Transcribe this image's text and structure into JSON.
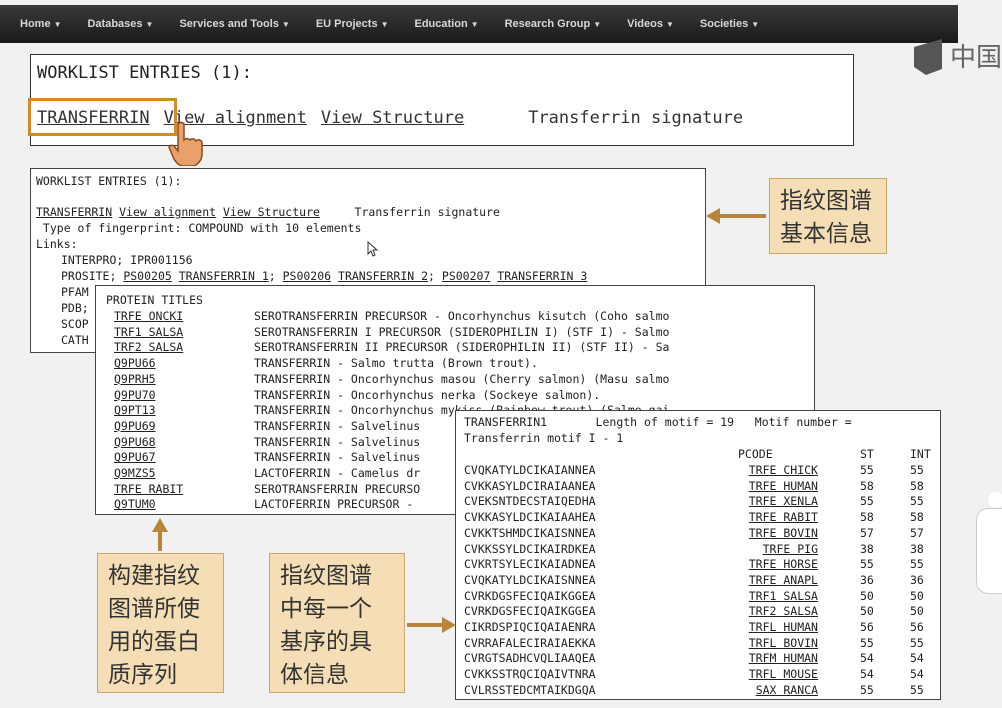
{
  "nav": [
    {
      "label": "Home"
    },
    {
      "label": "Databases"
    },
    {
      "label": "Services and Tools"
    },
    {
      "label": "EU Projects"
    },
    {
      "label": "Education"
    },
    {
      "label": "Research Group"
    },
    {
      "label": "Videos"
    },
    {
      "label": "Societies"
    }
  ],
  "logo_text": "中国",
  "big_box": {
    "title": "WORKLIST ENTRIES (1):",
    "link1": "TRANSFERRIN",
    "link2": "View alignment",
    "link3": "View Structure",
    "signature": "Transferrin signature"
  },
  "panel1": {
    "title": "WORKLIST ENTRIES (1):",
    "link1": "TRANSFERRIN",
    "link2": "View alignment",
    "link3": "View Structure",
    "signature": "Transferrin signature",
    "fingerprint": " Type of fingerprint: COMPOUND with 10 elements",
    "links_label": "Links:",
    "interpro": "INTERPRO; IPR001156",
    "prosite_prefix": "PROSITE;",
    "ps1": "PS00205",
    "ps1n": "TRANSFERRIN 1",
    "ps2": "PS00206",
    "ps2n": "TRANSFERRIN 2",
    "ps3": "PS00207",
    "ps3n": "TRANSFERRIN 3",
    "pfam": "PFAM",
    "pdb": "PDB;",
    "scop": "SCOP",
    "cath": "CATH"
  },
  "panel2": {
    "header": "PROTEIN TITLES",
    "rows": [
      {
        "id": "TRFE ONCKI",
        "title": "SEROTRANSFERRIN PRECURSOR - Oncorhynchus kisutch (Coho salmo"
      },
      {
        "id": "TRF1 SALSA",
        "title": "SEROTRANSFERRIN I PRECURSOR (SIDEROPHILIN I) (STF I) - Salmo"
      },
      {
        "id": "TRF2 SALSA",
        "title": "SEROTRANSFERRIN II PRECURSOR (SIDEROPHILIN II) (STF II) - Sa"
      },
      {
        "id": "Q9PU66",
        "title": "TRANSFERRIN - Salmo trutta (Brown trout)."
      },
      {
        "id": "Q9PRH5",
        "title": "TRANSFERRIN - Oncorhynchus masou (Cherry salmon) (Masu salmo"
      },
      {
        "id": "Q9PU70",
        "title": "TRANSFERRIN - Oncorhynchus nerka (Sockeye salmon)."
      },
      {
        "id": "Q9PT13",
        "title": "TRANSFERRIN - Oncorhynchus mykiss (Rainbow trout) (Salmo gai"
      },
      {
        "id": "Q9PU69",
        "title": "TRANSFERRIN - Salvelinus"
      },
      {
        "id": "Q9PU68",
        "title": "TRANSFERRIN - Salvelinus"
      },
      {
        "id": "Q9PU67",
        "title": "TRANSFERRIN - Salvelinus"
      },
      {
        "id": "Q9MZS5",
        "title": "LACTOFERRIN - Camelus dr"
      },
      {
        "id": "TRFE RABIT",
        "title": "SEROTRANSFERRIN PRECURSO"
      },
      {
        "id": "Q9TUM0",
        "title": "LACTOFERRIN PRECURSOR -"
      }
    ]
  },
  "panel3": {
    "line1": "TRANSFERRIN1       Length of motif = 19   Motif number =",
    "line2": "Transferrin motif I - 1",
    "col_pcode": "PCODE",
    "col_st": "ST",
    "col_int": "INT",
    "rows": [
      {
        "seq": "CVQKATYLDCIKAIANNEA",
        "pcode": "TRFE CHICK",
        "st": "55",
        "int": "55"
      },
      {
        "seq": "CVKKASYLDCIRAIAANEA",
        "pcode": "TRFE HUMAN",
        "st": "58",
        "int": "58"
      },
      {
        "seq": "CVEKSNTDECSTAIQEDHA",
        "pcode": "TRFE XENLA",
        "st": "55",
        "int": "55"
      },
      {
        "seq": "CVKKASYLDCIKAIAAHEA",
        "pcode": "TRFE RABIT",
        "st": "58",
        "int": "58"
      },
      {
        "seq": "CVKKTSHMDCIKAISNNEA",
        "pcode": "TRFE BOVIN",
        "st": "57",
        "int": "57"
      },
      {
        "seq": "CVKKSSYLDCIKAIRDKEA",
        "pcode": "TRFE PIG",
        "st": "38",
        "int": "38"
      },
      {
        "seq": "CVKRTSYLECIKAIADNEA",
        "pcode": "TRFE HORSE",
        "st": "55",
        "int": "55"
      },
      {
        "seq": "CVQKATYLDCIKAISNNEA",
        "pcode": "TRFE ANAPL",
        "st": "36",
        "int": "36"
      },
      {
        "seq": "CVRKDGSFECIQAIKGGEA",
        "pcode": "TRF1 SALSA",
        "st": "50",
        "int": "50"
      },
      {
        "seq": "CVRKDGSFECIQAIKGGEA",
        "pcode": "TRF2 SALSA",
        "st": "50",
        "int": "50"
      },
      {
        "seq": "CIKRDSPIQCIQAIAENRA",
        "pcode": "TRFL HUMAN",
        "st": "56",
        "int": "56"
      },
      {
        "seq": "CVRRAFALECIRAIAEKKA",
        "pcode": "TRFL BOVIN",
        "st": "55",
        "int": "55"
      },
      {
        "seq": "CVRGTSADHCVQLIAAQEA",
        "pcode": "TRFM HUMAN",
        "st": "54",
        "int": "54"
      },
      {
        "seq": "CVKKSSTRQCIQAIVTNRA",
        "pcode": "TRFL MOUSE",
        "st": "54",
        "int": "54"
      },
      {
        "seq": "CVLRSSTEDCMTAIKDGQA",
        "pcode": "SAX RANCA",
        "st": "55",
        "int": "55"
      }
    ]
  },
  "callouts": {
    "c1": [
      "指纹图谱",
      "基本信息"
    ],
    "c2": [
      "构建指纹",
      "图谱所使",
      "用的蛋白",
      "质序列"
    ],
    "c3": [
      "指纹图谱",
      "中每一个",
      "基序的具",
      "体信息"
    ]
  },
  "colors": {
    "accent": "#d4892a",
    "callout_bg": "#f5deb5",
    "nav_bg": "#1a1a1a"
  }
}
